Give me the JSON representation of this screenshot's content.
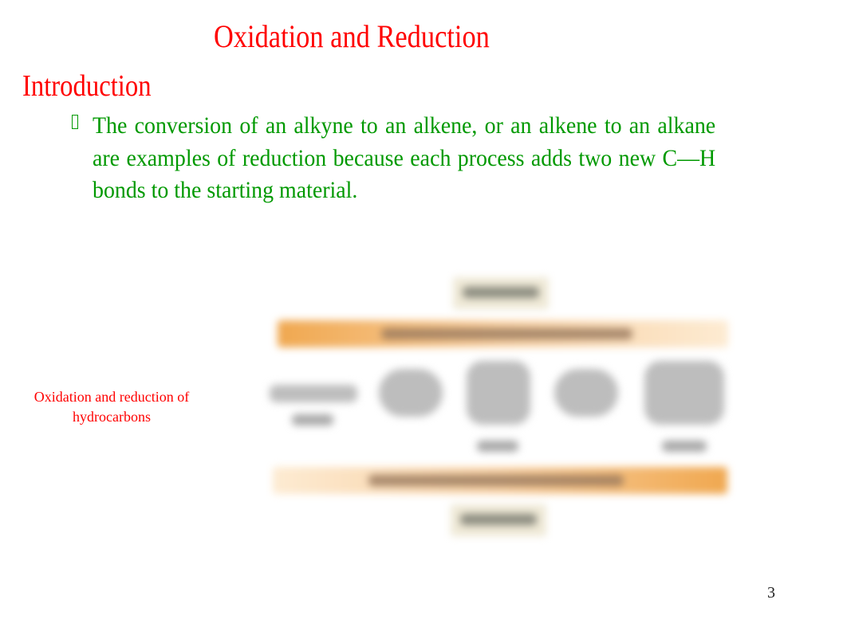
{
  "slide": {
    "title": "Oxidation and Reduction",
    "heading": "Introduction",
    "bullet": {
      "icon": "missing-glyph-bullet",
      "text": "The conversion of an alkyne to an alkene, or an alkene to an alkane are examples of reduction because each process adds two new C—H bonds to the starting material."
    },
    "figure_caption": "Oxidation and reduction of hydrocarbons",
    "page_number": "3",
    "diagram": {
      "description": "Blurred diagram: oxidation/reduction of hydrocarbons (alkyne, alkene, alkane) with arrows",
      "colors": {
        "arrow_light": "#fdebd2",
        "arrow_dark": "#f0a850",
        "box": "#efe9d6"
      }
    }
  }
}
